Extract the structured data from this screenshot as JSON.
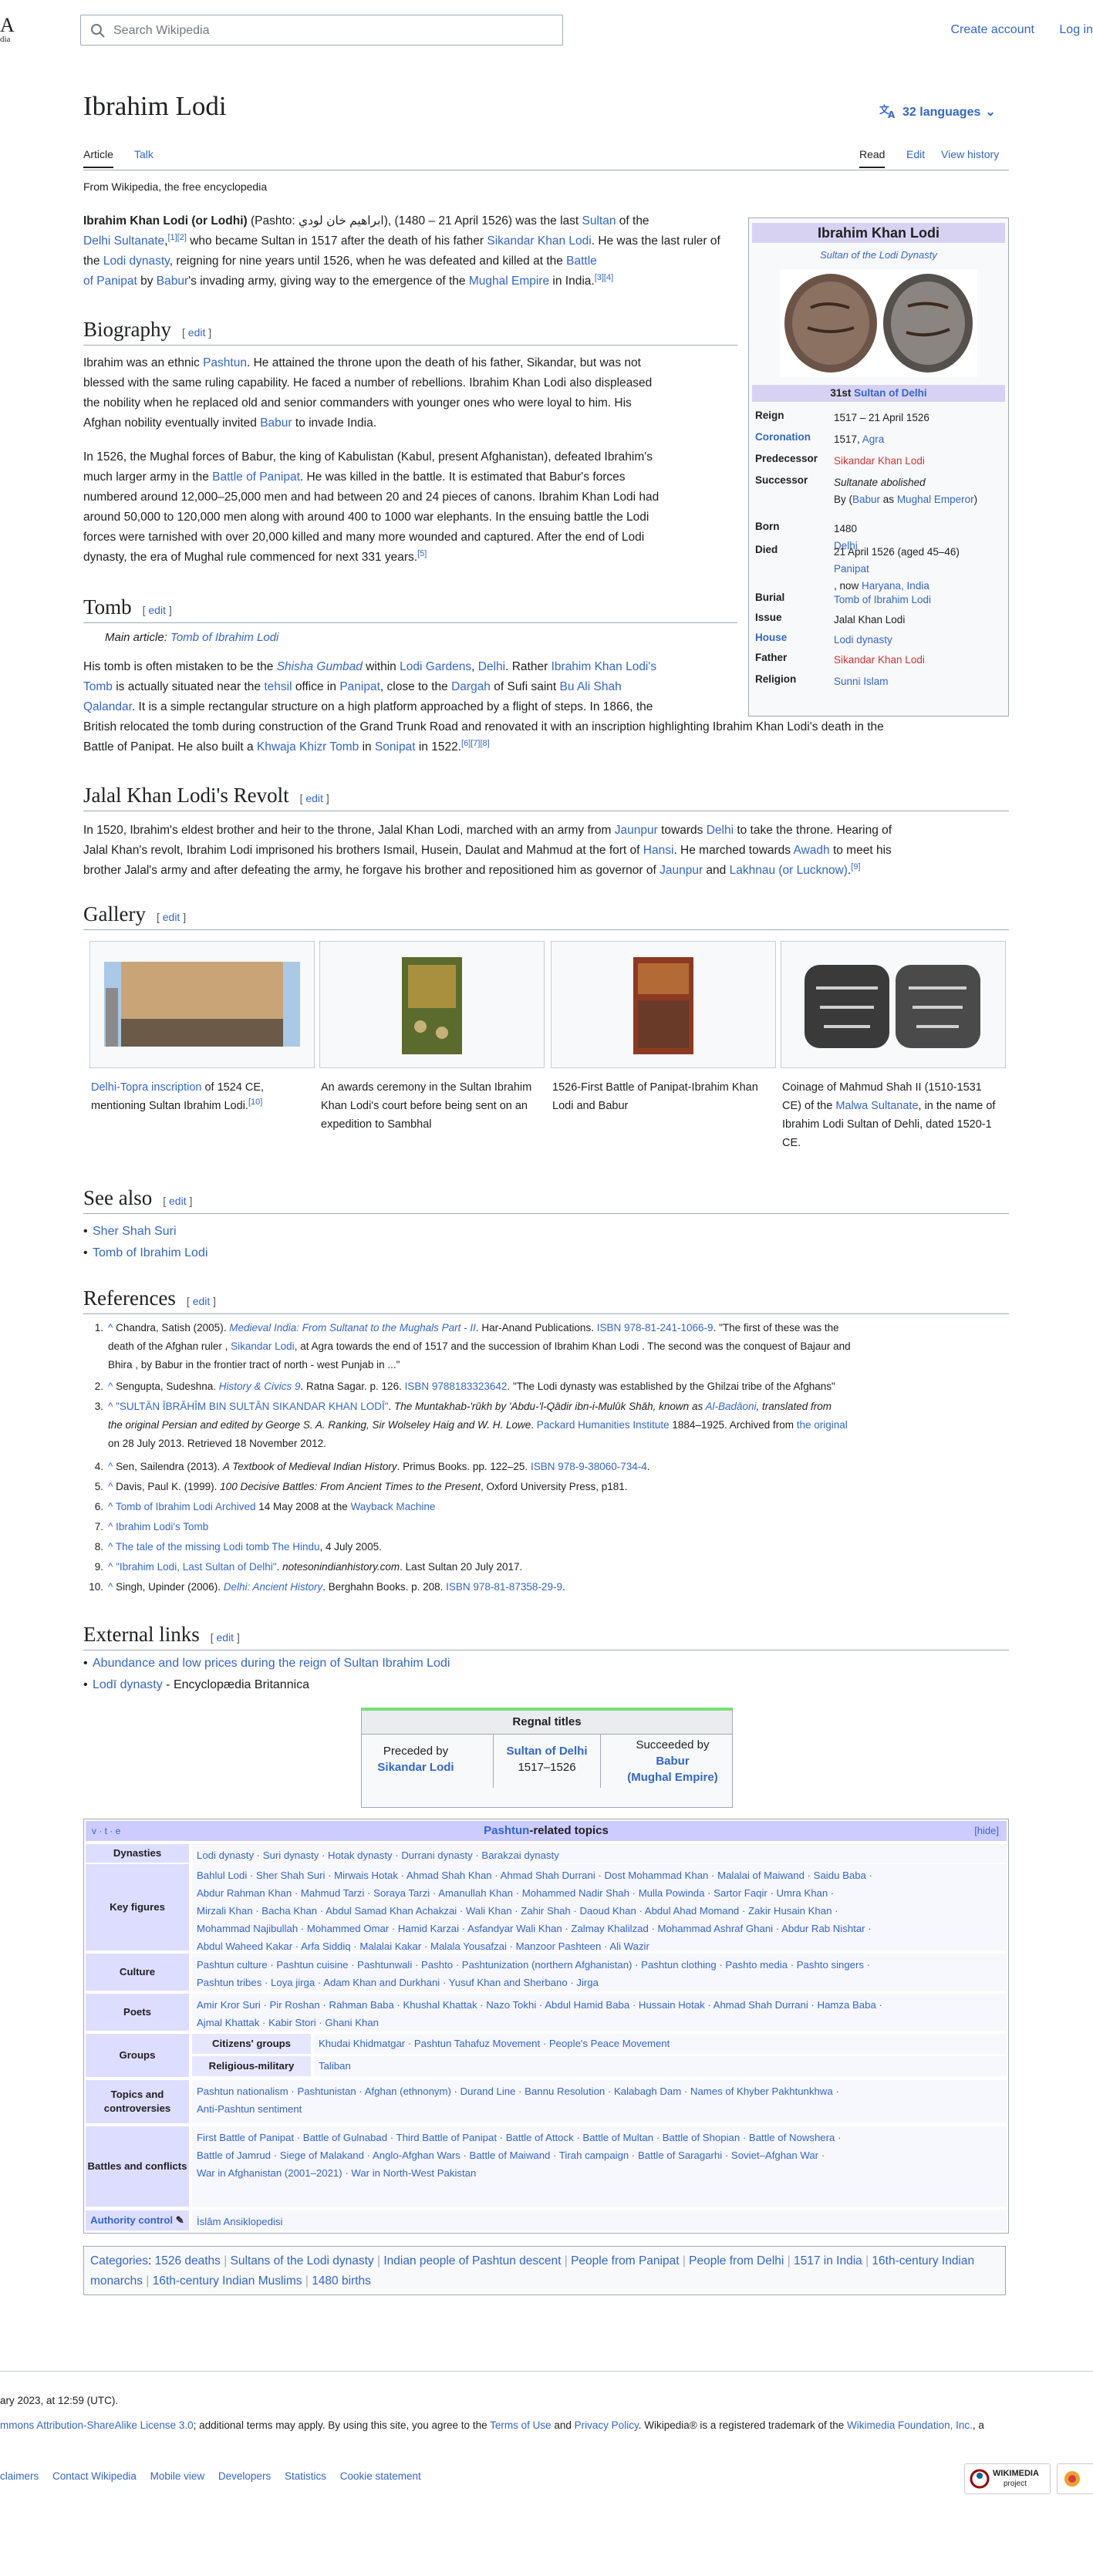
{
  "header": {
    "logo_fragment": "A",
    "logo_sub": "dia",
    "search_placeholder": "Search Wikipedia",
    "create_account": "Create account",
    "log_in": "Log in"
  },
  "page": {
    "title": "Ibrahim Lodi",
    "languages": "32 languages",
    "tab_article": "Article",
    "tab_talk": "Talk",
    "tab_read": "Read",
    "tab_edit": "Edit",
    "tab_history": "View history",
    "tagline": "From Wikipedia, the free encyclopedia"
  },
  "intro": {
    "bold": "Ibrahim Khan Lodi (or Lodhi)",
    "pashto_label": " (Pashto: ",
    "pashto": "ابراهیم خان لودي",
    "dates": "), (21 – 1480 April 1526) was the last ",
    "sultan": "Sultan",
    "of_the": " of the ",
    "l2a": "Delhi Sultanate",
    ",": ",",
    "ref12": "[1][2]",
    "who": " who became Sultan in 1517 after the death of his father ",
    "sikandar": "Sikandar Khan Lodi",
    ".": ".",
    "l3a": "He was the last ruler of the ",
    "lodi": "Lodi dynasty",
    "reign": ", reigning for nine years until 1526, when he was defeated and killed at the ",
    "battle": "Battle",
    "l4a": "of Panipat",
    "by": " by ",
    "babur": "Babur",
    "inv": "'s invading army, giving way to the emergence of the ",
    "mughal": "Mughal Empire",
    "india": " in India.",
    "ref34": "[3][4]"
  },
  "bio": {
    "heading": "Biography",
    "edit": "edit",
    "p1": [
      "Ibrahim was an ethnic ",
      "Pashtun",
      ". He attained the throne upon the death of his father, Sikandar, but was not",
      "blessed with the same ruling capability. He faced a number of rebellions. Ibrahim Khan Lodi also displeased",
      "the nobility when he replaced old and senior commanders with younger ones who were loyal to him. His",
      "Afghan nobility eventually invited ",
      "Babur",
      " to invade India."
    ],
    "p2": [
      "In 1526, the Mughal forces of Babur, the king of Kabulistan (Kabul, present Afghanistan), defeated Ibrahim's",
      "much larger army in the ",
      "Battle of Panipat",
      ". He was killed in the battle. It is estimated that Babur's forces",
      "numbered around 12,000–25,000 men and had between 20 and 24 pieces of canons. Ibrahim Khan Lodi had",
      "around 50,000 to 120,000 men along with around 400 to 1000 war elephants. In the ensuing battle the Lodi",
      "forces were tarnished with over 20,000 killed and many more wounded and captured. After the end of Lodi",
      "dynasty, the era of Mughal rule commenced for next 331 years.",
      "[5]"
    ]
  },
  "tomb": {
    "heading": "Tomb",
    "edit": "edit",
    "main_label": "Main article: ",
    "main_link": "Tomb of Ibrahim Lodi",
    "t": [
      "His tomb is often mistaken to be the ",
      "Shisha Gumbad",
      " within ",
      "Lodi Gardens",
      ", ",
      "Delhi",
      ". Rather ",
      "Ibrahim Khan Lodi's",
      "Tomb",
      " is actually situated near the ",
      "tehsil",
      " office in ",
      "Panipat",
      ", close to the ",
      "Dargah",
      " of Sufi saint ",
      "Bu Ali Shah",
      "Qalandar",
      ". It is a simple rectangular structure on a high platform approached by a flight of steps. In 1866, the",
      "British relocated the tomb during construction of the Grand Trunk Road and renovated it with an inscription highlighting Ibrahim Khan Lodi's death in the",
      "Battle of Panipat. He also built a ",
      "Khwaja Khizr Tomb",
      " in ",
      "Sonipat",
      " in 1522.",
      "[6][7][8]"
    ]
  },
  "revolt": {
    "heading": "Jalal Khan Lodi's Revolt",
    "edit": "edit",
    "t": [
      "In 1520, Ibrahim's eldest brother and heir to the throne, Jalal Khan Lodi, marched with an army from ",
      "Jaunpur",
      " towards ",
      "Delhi",
      " to take the throne. Hearing of",
      "Jalal Khan's revolt, Ibrahim Lodi imprisoned his brothers Ismail, Husein, Daulat and Mahmud at the fort of ",
      "Hansi",
      ". He marched towards ",
      "Awadh",
      " to meet his",
      "brother Jalal's army and after defeating the army, he forgave his brother and repositioned him as governor of ",
      "Jaunpur",
      " and ",
      "Lakhnau (or Lucknow)",
      ".",
      "[9]"
    ]
  },
  "gallery": {
    "heading": "Gallery",
    "edit": "edit",
    "c1a": "Delhi-Topra inscription",
    "c1b": " of 1524 CE, mentioning Sultan Ibrahim Lodi.",
    "c1r": "[10]",
    "c2": "An awards ceremony in the Sultan Ibrahim Khan Lodi's court before being sent on an expedition to Sambhal",
    "c3": "1526-First Battle of Panipat-Ibrahim Khan Lodi and Babur",
    "c4a": "Coinage of Mahmud Shah II (1510-1531 CE) of the ",
    "c4l": "Malwa Sultanate",
    "c4b": ", in the name of Ibrahim Lodi Sultan of Dehli, dated 1520-1 CE."
  },
  "see_also": {
    "heading": "See also",
    "edit": "edit",
    "items": [
      "Sher Shah Suri",
      "Tomb of Ibrahim Lodi"
    ]
  },
  "references": {
    "heading": "References",
    "edit": "edit",
    "r1": [
      "Chandra, Satish (2005). ",
      "Medieval India: From Sultanat to the Mughals Part - II",
      ". Har-Anand Publications. ",
      "ISBN 978-81-241-1066-9",
      ". \"The first of these was the",
      "death of the Afghan ruler , ",
      "Sikandar Lodi",
      ", at Agra towards the end of 1517 and the succession of Ibrahim Khan Lodi . The second was the conquest of Bajaur and",
      "Bhira , by Babur in the frontier tract of north - west Punjab in ...\""
    ],
    "r2": [
      "Sengupta, Sudeshna. ",
      "History & Civics 9",
      ". Ratna Sagar. p. 126. ",
      "ISBN 9788183323642",
      ". \"The Lodi dynasty was established by the Ghilzai tribe of the Afghans\""
    ],
    "r3": [
      "\"SULTĀN ĪBRĀHĪM BIN SULTĀN SIKANDAR KHAN LODĪ\"",
      ". ",
      "The Muntakhab-'rūkh by 'Abdu-'l-Qādir ibn-i-Mulūk Shāh, known as ",
      "Al-Badāoni",
      ", translated from",
      "the original Persian and edited by George S. A. Ranking, Sir Wolseley Haig and W. H. Lowe",
      ". ",
      "Packard Humanities Institute",
      " 1884–1925. Archived from ",
      "the original",
      "on 28 July 2013. Retrieved 18 November 2012."
    ],
    "r4": [
      "Sen, Sailendra (2013). ",
      "A Textbook of Medieval Indian History",
      ". Primus Books. pp. 122–25. ",
      "ISBN 978-9-38060-734-4",
      "."
    ],
    "r5": [
      "Davis, Paul K. (1999). ",
      "100 Decisive Battles: From Ancient Times to the Present",
      ", Oxford University Press, p181."
    ],
    "r6": [
      "Tomb of Ibrahim Lodi",
      " ",
      "Archived",
      " 14 May 2008 at the ",
      "Wayback Machine"
    ],
    "r7": [
      "Ibrahim Lodi's Tomb"
    ],
    "r8": [
      "The tale of the missing Lodi tomb",
      " ",
      "The Hindu",
      ", 4 July 2005."
    ],
    "r9": [
      "\"Ibrahim Lodi, Last Sultan of Delhi\"",
      ". ",
      "notesonindianhistory.com",
      ". Last Sultan 20 July 2017."
    ],
    "r10": [
      "Singh, Upinder (2006). ",
      "Delhi: Ancient History",
      ". Berghahn Books. p. 208. ",
      "ISBN 978-81-87358-29-9",
      "."
    ]
  },
  "external": {
    "heading": "External links",
    "edit": "edit",
    "items": [
      "Abundance and low prices during the reign of Sultan Ibrahim Lodi",
      "Lodī dynasty"
    ],
    "eb": " - Encyclopædia Britannica"
  },
  "regnal": {
    "title": "Regnal titles",
    "prec_label": "Preceded by",
    "prec": "Sikandar Lodi",
    "office": "Sultan of Delhi",
    "years": "1517–1526",
    "succ_label": "Succeeded by",
    "succ": "Babur",
    "succ2": "(Mughal Empire)"
  },
  "navbox": {
    "vte": "v · t · e",
    "title_link": "Pashtun",
    "title_rest": "-related topics",
    "hide": "[hide]",
    "groups": [
      {
        "name": "Dynasties",
        "lines": [
          "Lodi dynasty · Suri dynasty · Hotak dynasty · Durrani dynasty · Barakzai dynasty"
        ]
      },
      {
        "name": "Key figures",
        "lines": [
          "Bahlul Lodi · Sher Shah Suri · Mirwais Hotak · Ahmad Shah Khan · Ahmad Shah Durrani · Dost Mohammad Khan · Malalai of Maiwand · Saidu Baba ·",
          "Abdur Rahman Khan · Mahmud Tarzi · Soraya Tarzi · Amanullah Khan · Mohammed Nadir Shah · Mulla Powinda · Sartor Faqir · Umra Khan ·",
          "Mirzali Khan · Bacha Khan · Abdul Samad Khan Achakzai · Wali Khan · Zahir Shah · Daoud Khan · Abdul Ahad Momand · Zakir Husain Khan ·",
          "Mohammad Najibullah · Mohammed Omar · Hamid Karzai · Asfandyar Wali Khan · Zalmay Khalilzad · Mohammad Ashraf Ghani · Abdur Rab Nishtar ·",
          "Abdul Waheed Kakar · Arfa Siddiq · Malalai Kakar · Malala Yousafzai · Manzoor Pashteen · Ali Wazir"
        ]
      },
      {
        "name": "Culture",
        "lines": [
          "Pashtun culture · Pashtun cuisine · Pashtunwali · Pashto · Pashtunization (northern Afghanistan) · Pashtun clothing · Pashto media · Pashto singers ·",
          "Pashtun tribes · Loya jirga · Adam Khan and Durkhani · Yusuf Khan and Sherbano · Jirga"
        ]
      },
      {
        "name": "Poets",
        "lines": [
          "Amir Kror Suri · Pir Roshan · Rahman Baba · Khushal Khattak · Nazo Tokhi · Abdul Hamid Baba · Hussain Hotak · Ahmad Shah Durrani · Hamza Baba ·",
          "Ajmal Khattak · Kabir Stori · Ghani Khan"
        ]
      },
      {
        "name": "Groups",
        "sub": [
          {
            "name": "Citizens' groups",
            "val": "Khudai Khidmatgar · Pashtun Tahafuz Movement · People's Peace Movement"
          },
          {
            "name": "Religious-military",
            "val": "Taliban"
          }
        ]
      },
      {
        "name": "Topics and controversies",
        "lines": [
          "Pashtun nationalism · Pashtunistan · Afghan (ethnonym) · Durand Line · Bannu Resolution · Kalabagh Dam · Names of Khyber Pakhtunkhwa ·",
          "Anti-Pashtun sentiment"
        ]
      },
      {
        "name": "Battles and conflicts",
        "lines": [
          "First Battle of Panipat · Battle of Gulnabad · Third Battle of Panipat · Battle of Attock · Battle of Multan · Battle of Shopian · Battle of Nowshera ·",
          "Battle of Jamrud · Siege of Malakand · Anglo-Afghan Wars · Battle of Maiwand · Tirah campaign · Battle of Saragarhi · Soviet–Afghan War ·",
          "War in Afghanistan (2001–2021) · War in North-West Pakistan"
        ]
      }
    ],
    "authority_label": "Authority control",
    "authority_val": "İslâm Ansiklopedisi"
  },
  "categories": {
    "label": "Categories",
    "items": [
      "1526 deaths",
      "Sultans of the Lodi dynasty",
      "Indian people of Pashtun descent",
      "People from Panipat",
      "People from Delhi",
      "1517 in India",
      "16th-century Indian monarchs",
      "16th-century Indian Muslims",
      "1480 births"
    ]
  },
  "infobox": {
    "title": "Ibrahim Khan Lodi",
    "subtitle": "Sultan of the Lodi Dynasty",
    "rank_pre": "31st ",
    "rank_link": "Sultan of Delhi",
    "rows": [
      {
        "label": "Reign",
        "v": [
          "1517 – 21 April 1526"
        ]
      },
      {
        "label": "Coronation",
        "v": [
          "1517, ",
          "Agra"
        ]
      },
      {
        "label": "Predecessor",
        "v": [
          "Sikandar Khan Lodi"
        ]
      },
      {
        "label": "Successor",
        "v": [
          "Sultanate abolished",
          "By (",
          "Babur",
          " as ",
          "Mughal Emperor",
          ")"
        ]
      },
      {
        "label": "Born",
        "v": [
          "1480",
          "Delhi"
        ]
      },
      {
        "label": "Died",
        "v": [
          "21 April 1526 (aged 45–46)",
          "Panipat",
          ", now ",
          "Haryana, India"
        ]
      },
      {
        "label": "Burial",
        "v": [
          "Tomb of Ibrahim Lodi"
        ]
      },
      {
        "label": "Issue",
        "v": [
          "Jalal Khan Lodi"
        ]
      },
      {
        "label": "House",
        "v": [
          "Lodi dynasty"
        ]
      },
      {
        "label": "Father",
        "v": [
          "Sikandar Khan Lodi"
        ]
      },
      {
        "label": "Religion",
        "v": [
          "Sunni Islam"
        ]
      }
    ]
  },
  "footer": {
    "edited": "ary 2023, at 12:59 (UTC).",
    "license_a": "mmons Attribution-ShareAlike License 3.0",
    "license_b": "; additional terms may apply. By using this site, you agree to the ",
    "terms": "Terms of Use",
    "and": " and ",
    "privacy": "Privacy Policy",
    ". Wikipedia® is a registered trademark of the ": ". Wikipedia® is a registered trademark of the ",
    "wmf": "Wikimedia Foundation, Inc.",
    ", a": ", a",
    "links": [
      "claimers",
      "Contact Wikipedia",
      "Mobile view",
      "Developers",
      "Statistics",
      "Cookie statement"
    ],
    "badge1": "WIKIMEDIA",
    "badge1b": "project"
  },
  "colors": {
    "link": "#3366cc",
    "redlink": "#d73333",
    "infobox_header": "#d8d2f2",
    "navbox_title": "#ccccff",
    "navbox_group": "#ddddff",
    "regnal_bar": "#77e077"
  }
}
